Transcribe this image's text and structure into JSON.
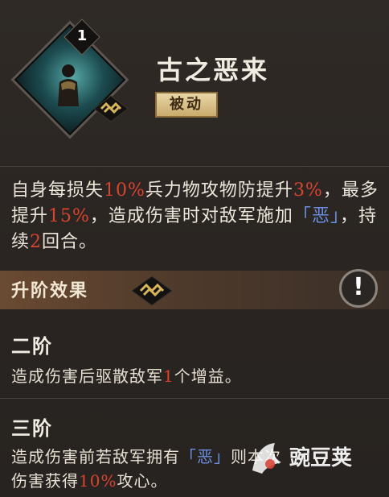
{
  "skill": {
    "level": "1",
    "name": "古之恶来",
    "type_tag": "被动"
  },
  "description": {
    "p1": "自身每损失",
    "v1": "10%",
    "p2": "兵力物攻物防提升",
    "v2": "3%",
    "p3": "，最多提升",
    "v3": "15%",
    "p4": "，造成伤害时对敌军施加",
    "status": "「恶」",
    "p5": "，持续",
    "v4": "2",
    "p6": "回合。"
  },
  "upgrade": {
    "header": "升阶效果",
    "info_symbol": "!",
    "tier2": {
      "title": "二阶",
      "t1": "造成伤害后驱散敌军",
      "v1": "1",
      "t2": "个增益。"
    },
    "tier3": {
      "title": "三阶",
      "t1": "造成伤害前若敌军拥有",
      "status": "「恶」",
      "t2": "则本次",
      "t3": "伤害获得",
      "v1": "10%",
      "t4": "攻心。"
    }
  },
  "watermark": {
    "text": "豌豆荚"
  },
  "colors": {
    "highlight_red": "#d9442e",
    "status_blue": "#6a8fe0",
    "tag_gold": "#c9ab6c"
  }
}
